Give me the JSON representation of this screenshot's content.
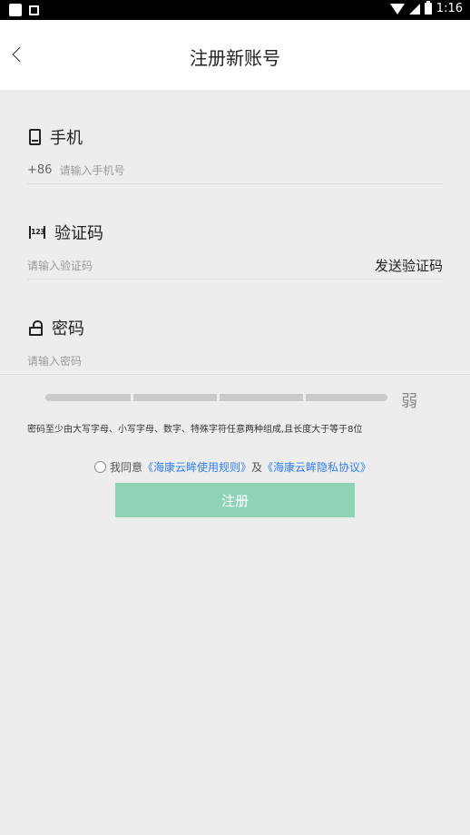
{
  "status_bar": {
    "time": "1:16"
  },
  "header": {
    "title": "注册新账号"
  },
  "phone": {
    "label": "手机",
    "prefix": "+86",
    "placeholder": "请输入手机号"
  },
  "code": {
    "label": "验证码",
    "icon_text": "123",
    "placeholder": "请输入验证码",
    "send_label": "发送验证码"
  },
  "password": {
    "label": "密码",
    "placeholder": "请输入密码",
    "strength_label": "弱",
    "strength_level": 0,
    "hint": "密码至少由大写字母、小写字母、数字、特殊字符任意两种组成,且长度大于等于8位"
  },
  "agreement": {
    "prefix": "我同意",
    "terms_link": "《海康云眸使用规则》",
    "conjunction": "及",
    "privacy_link": "《海康云眸隐私协议》"
  },
  "register_button": {
    "label": "注册"
  },
  "colors": {
    "accent": "#8fd3b7",
    "link": "#2f7fe8",
    "background": "#ededed"
  }
}
